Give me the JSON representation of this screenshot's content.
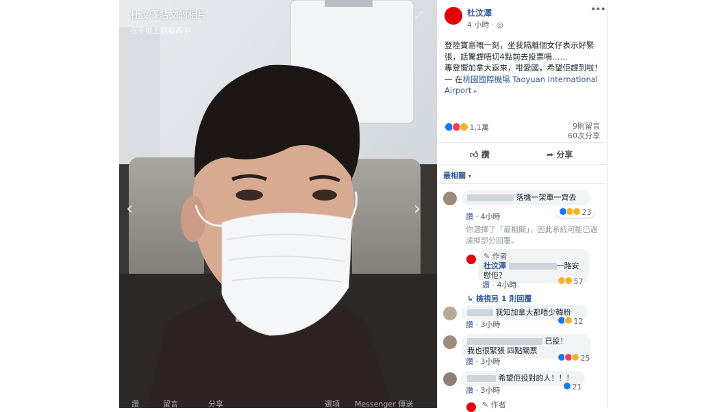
{
  "photo": {
    "caption": "杜汶澤貼文的相片",
    "subcaption": "在手機上觀看高中",
    "bottom_like": "讚",
    "bottom_comment": "留言",
    "bottom_share": "分享",
    "bottom_options": "選項",
    "bottom_messenger": "Messenger 傳送"
  },
  "post": {
    "author": "杜汶澤",
    "time": "4 小時 · ",
    "line1": "登陸寶島嘅一刻，坐我隔離個女仔表示好緊張，話驚趕唔切4點前去投票喎……",
    "line2": "專登嚮加拿大返來，咁愛國，希望佢趕到啦！— 在",
    "location": "桃園國際機場 Taoyuan International Airport",
    "reactions": "1,1萬",
    "comments_count": "9則留言",
    "shares_count": "60次分享",
    "like_label": "讚",
    "share_label": "分享",
    "sort_label": "最相關"
  },
  "comments": [
    {
      "text": "落機一架車一齊去",
      "like": "讚",
      "time": "4小時",
      "react": "23"
    },
    {
      "note": "你選擇了「最相關」，因此系統可能已過濾掉部分回覆。"
    },
    {
      "tag": "作者",
      "author": "杜汶澤",
      "text_end": "一路安",
      "text2": "慰佢？",
      "like": "讚",
      "time": "4小時",
      "react": "57"
    },
    {
      "reply_link": "檢視另 1 則回覆"
    },
    {
      "text": "我知加拿大都唔少韓粉",
      "like": "讚",
      "time": "3小時",
      "react": "12"
    },
    {
      "text": "已投！",
      "text2": "我也很緊張 四點關票",
      "like": "讚",
      "time": "3小時",
      "react": "25"
    },
    {
      "text": "希望佢投對的人！！！",
      "like": "讚",
      "time": "3小時",
      "react": "21"
    },
    {
      "tag": "作者"
    }
  ],
  "colors": {
    "brand_red": "#e4000b",
    "link_blue": "#365899",
    "like_blue": "#1877f2"
  }
}
